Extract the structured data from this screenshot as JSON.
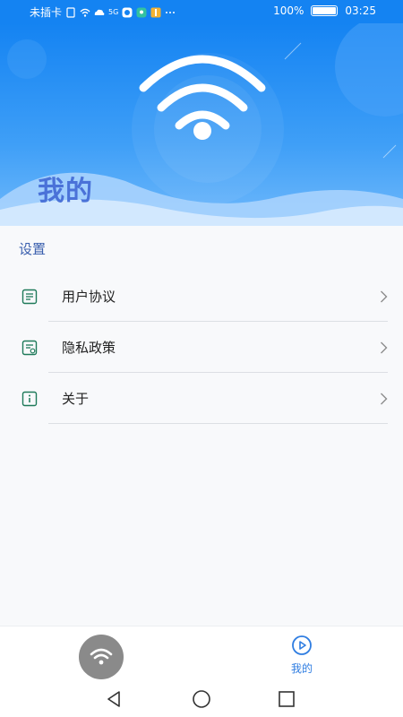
{
  "status_bar": {
    "carrier": "未插卡",
    "network": "5G",
    "battery_text": "100%",
    "battery_level": 1.0,
    "time": "03:25"
  },
  "header": {
    "title": "我的"
  },
  "settings": {
    "section_title": "设置",
    "items": [
      {
        "label": "用户协议",
        "icon": "document-icon"
      },
      {
        "label": "隐私政策",
        "icon": "privacy-document-icon"
      },
      {
        "label": "关于",
        "icon": "info-icon"
      }
    ]
  },
  "bottom_nav": {
    "wifi_icon": "wifi-icon",
    "mine_label": "我的",
    "mine_icon": "play-circle-icon"
  },
  "system_nav": {
    "back": "back-triangle-icon",
    "home": "home-circle-icon",
    "recents": "recents-square-icon"
  },
  "colors": {
    "header_blue": "#1483f2",
    "accent_blue": "#2f7de1",
    "section_text": "#3a5fae",
    "icon_green": "#1e7a5a"
  }
}
